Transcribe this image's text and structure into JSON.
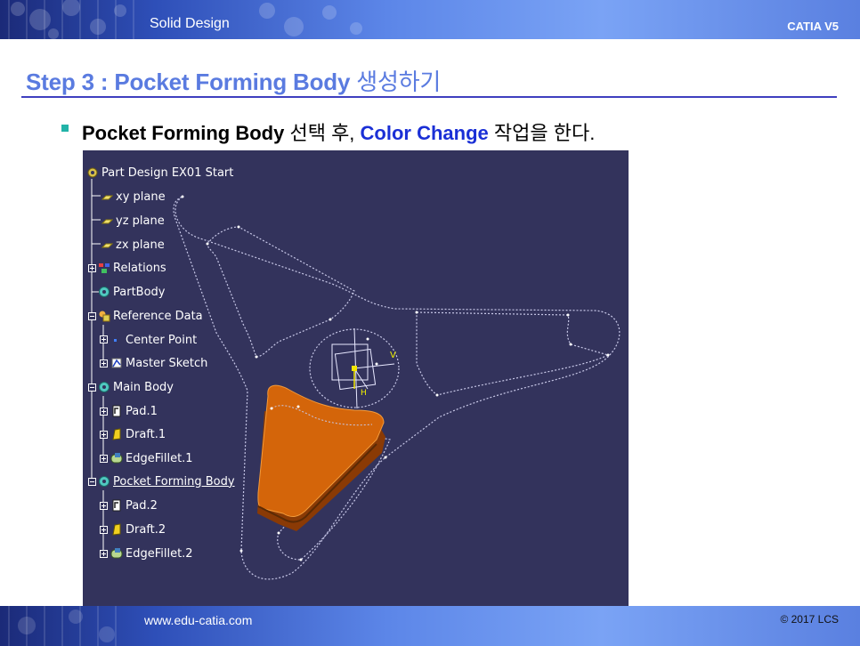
{
  "header": {
    "left_title": "Solid Design",
    "right_title": "CATIA V5"
  },
  "slide": {
    "title_en": "Step 3 : Pocket Forming Body",
    "title_ko": " 생성하기",
    "bullet": {
      "part1": "Pocket Forming Body",
      "part2": " 선택 후, ",
      "part3": "Color Change",
      "part4": " 작업을 한다."
    }
  },
  "spec_tree": {
    "items": [
      {
        "label": "Part Design EX01 Start",
        "icon": "part-gear-icon",
        "toggle": null
      },
      {
        "label": "xy plane",
        "icon": "plane-icon",
        "toggle": null
      },
      {
        "label": "yz plane",
        "icon": "plane-icon",
        "toggle": null
      },
      {
        "label": "zx plane",
        "icon": "plane-icon",
        "toggle": null
      },
      {
        "label": "Relations",
        "icon": "relations-icon",
        "toggle": "plus"
      },
      {
        "label": "PartBody",
        "icon": "body-gear-icon",
        "toggle": null
      },
      {
        "label": "Reference Data",
        "icon": "geometrical-set-icon",
        "toggle": "minus"
      },
      {
        "label": "Center Point",
        "icon": "point-icon",
        "toggle": "plus"
      },
      {
        "label": "Master Sketch",
        "icon": "sketch-icon",
        "toggle": "plus"
      },
      {
        "label": "Main Body",
        "icon": "body-gear-icon",
        "toggle": "minus"
      },
      {
        "label": "Pad.1",
        "icon": "pad-icon",
        "toggle": "plus"
      },
      {
        "label": "Draft.1",
        "icon": "draft-icon",
        "toggle": "plus"
      },
      {
        "label": "EdgeFillet.1",
        "icon": "edge-fillet-icon",
        "toggle": "plus"
      },
      {
        "label": "Pocket Forming Body",
        "icon": "body-gear-icon",
        "toggle": "minus"
      },
      {
        "label": "Pad.2",
        "icon": "pad-icon",
        "toggle": "plus"
      },
      {
        "label": "Draft.2",
        "icon": "draft-icon",
        "toggle": "plus"
      },
      {
        "label": "EdgeFillet.2",
        "icon": "edge-fillet-icon",
        "toggle": "plus"
      }
    ]
  },
  "axis_labels": {
    "v": "V",
    "h": "H"
  },
  "colors": {
    "viewport_bg": "#33335c",
    "solid_body": "#d4650a",
    "title_blue": "#5a7be0",
    "accent_blue": "#1a2fd6"
  },
  "footer": {
    "url": "www.edu-catia.com",
    "copyright": "© 2017 LCS"
  }
}
